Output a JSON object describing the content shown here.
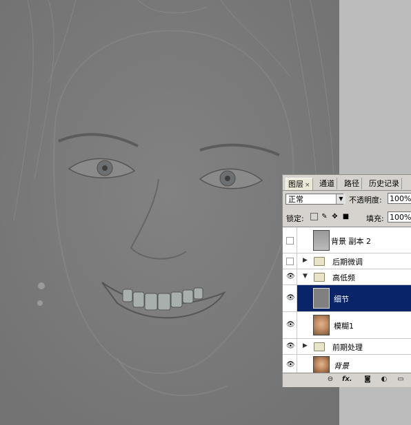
{
  "panel": {
    "tabs": [
      {
        "label": "图层",
        "close": "×"
      },
      {
        "label": "通道"
      },
      {
        "label": "路径"
      },
      {
        "label": "历史记录"
      }
    ],
    "blend_mode": "正常",
    "opacity_label": "不透明度:",
    "opacity_value": "100%",
    "lock_label": "锁定:",
    "fill_label": "填充:",
    "fill_value": "100%"
  },
  "layers": [
    {
      "name": "背景 副本 2",
      "type": "layer",
      "visible": false
    },
    {
      "name": "后期微调",
      "type": "group",
      "expanded": false,
      "visible": false
    },
    {
      "name": "高低频",
      "type": "group",
      "expanded": true,
      "visible": true
    },
    {
      "name": "细节",
      "type": "layer",
      "visible": true,
      "selected": true
    },
    {
      "name": "模糊1",
      "type": "layer",
      "visible": true
    },
    {
      "name": "前期处理",
      "type": "group",
      "expanded": false,
      "visible": true
    },
    {
      "name": "背景",
      "type": "layer",
      "visible": true,
      "italic": true
    }
  ],
  "footer_icons": [
    "link-icon",
    "fx-icon",
    "mask-icon",
    "adjustment-icon",
    "folder-icon"
  ],
  "footer_fx": "fx.",
  "colors": {
    "selection": "#0a246a",
    "panel_bg": "#d6d3ce",
    "canvas_gray": "#7a7a7a"
  }
}
